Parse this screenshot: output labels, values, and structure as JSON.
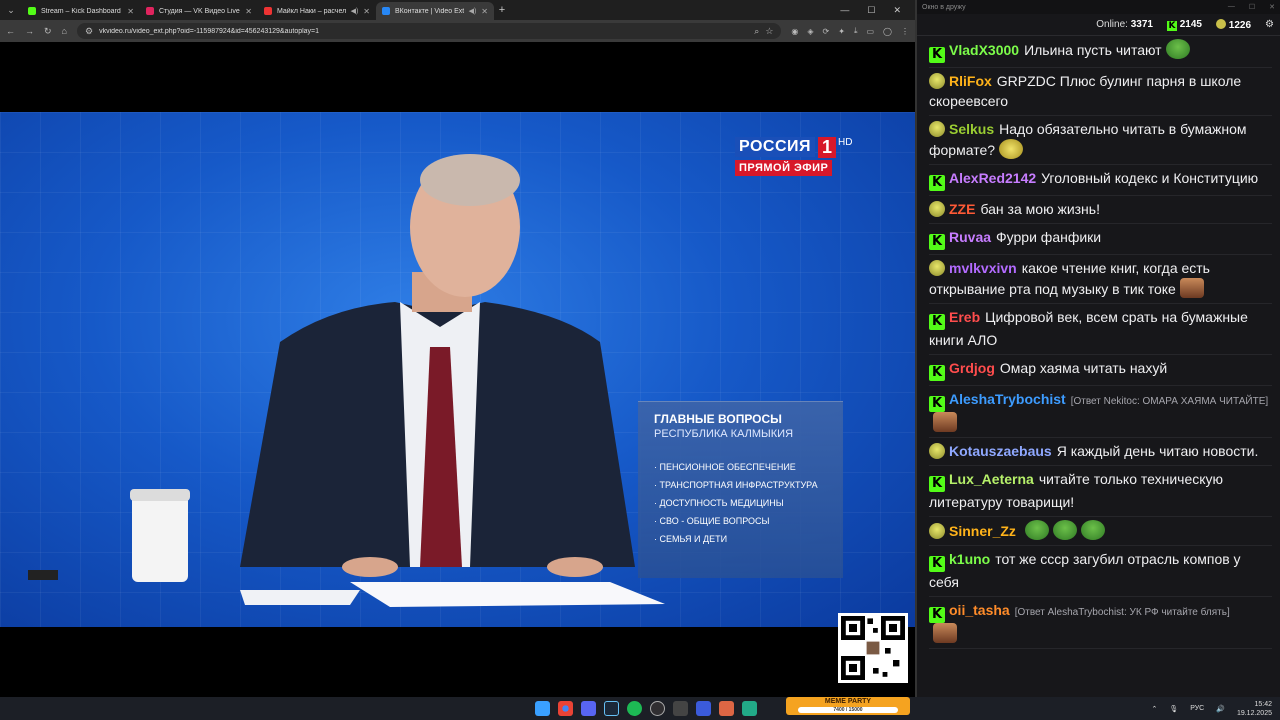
{
  "browser": {
    "tabs": [
      {
        "label": "Stream – Kick Dashboard",
        "color": "#53fc18"
      },
      {
        "label": "Студия — VK Видео Live",
        "color": "#e0245e"
      },
      {
        "label": "Майкл Наки – расчеловечив",
        "color": "#e33"
      },
      {
        "label": "ВКонтакте | Video Ext",
        "color": "#2787f5"
      }
    ],
    "url": "vkvideo.ru/video_ext.php?oid=-115987924&id=456243129&autoplay=1"
  },
  "video": {
    "channel_name": "РОССИЯ",
    "channel_number": "1",
    "channel_hd": "HD",
    "live_label": "ПРЯМОЙ ЭФИР",
    "lower_third": {
      "title": "ГЛАВНЫЕ ВОПРОСЫ",
      "subtitle": "РЕСПУБЛИКА КАЛМЫКИЯ",
      "items": [
        "ПЕНСИОННОЕ ОБЕСПЕЧЕНИЕ",
        "ТРАНСПОРТНАЯ ИНФРАСТРУКТУРА",
        "ДОСТУПНОСТЬ МЕДИЦИНЫ",
        "СВО - ОБЩИЕ ВОПРОСЫ",
        "СЕМЬЯ И ДЕТИ"
      ]
    }
  },
  "chat": {
    "window_title": "Окно в дружу",
    "online_label": "Online:",
    "online_count": "3371",
    "kick_count": "2145",
    "twitch_count": "1226",
    "messages": [
      {
        "platform": "kick",
        "user": "VladX3000",
        "color": "#7cfc4a",
        "text": "Ильина пусть читают",
        "emote": "pepe"
      },
      {
        "platform": "twitch",
        "user": "RliFox",
        "color": "#ffb31a",
        "text": "GRPZDC Плюс булинг парня в школе скореевсего"
      },
      {
        "platform": "twitch",
        "user": "Selkus",
        "color": "#9acd32",
        "text": "Надо обязательно читать в бумажном формате?",
        "emote": "ghost"
      },
      {
        "platform": "kick",
        "user": "AlexRed2142",
        "color": "#c77dff",
        "text": "Уголовный кодекс и Конституцию"
      },
      {
        "platform": "twitch",
        "user": "ZZE",
        "color": "#ff5a36",
        "text": "бан за мою жизнь!"
      },
      {
        "platform": "kick",
        "user": "Ruvaa",
        "color": "#c77dff",
        "text": "Фурри фанфики"
      },
      {
        "platform": "twitch",
        "user": "mvlkvxivn",
        "color": "#b36bff",
        "text": "какое чтение книг, когда есть открывание рта под музыку в тик токе",
        "emote": "face"
      },
      {
        "platform": "kick",
        "user": "Ereb",
        "color": "#ff4d4d",
        "text": "Цифровой век, всем срать на бумажные книги АЛО"
      },
      {
        "platform": "kick",
        "user": "Grdjog",
        "color": "#ff4d4d",
        "text": "Омар хаяма читать нахуй"
      },
      {
        "platform": "kick",
        "user": "AleshaTrybochist",
        "color": "#3d9cff",
        "reply": "[Ответ Nekitoc: ОМАРА ХАЯМА ЧИТАЙТЕ]",
        "emote": "face"
      },
      {
        "platform": "twitch",
        "user": "Kotauszaebaus",
        "color": "#8fa8ff",
        "text": "Я каждый день читаю новости."
      },
      {
        "platform": "kick",
        "user": "Lux_Aeterna",
        "color": "#b6f06a",
        "text": "читайте только техническую литературу товарищи!"
      },
      {
        "platform": "twitch",
        "user": "Sinner_Zz",
        "color": "#ffb31a",
        "text": "",
        "emote": "pepe3"
      },
      {
        "platform": "kick",
        "user": "k1uno",
        "color": "#7cfc4a",
        "text": "тот же ссср загубил отрасль компов у себя"
      },
      {
        "platform": "kick",
        "user": "oii_tasha",
        "color": "#ff8c2a",
        "reply": "[Ответ AleshaTrybochist: УК РФ читайте блять]",
        "emote": "face"
      }
    ]
  },
  "taskbar": {
    "widget_label": "MEME PARTY",
    "widget_progress": "7400 / 15000",
    "lang": "РУС",
    "time": "15:42",
    "date": "19.12.2025"
  }
}
